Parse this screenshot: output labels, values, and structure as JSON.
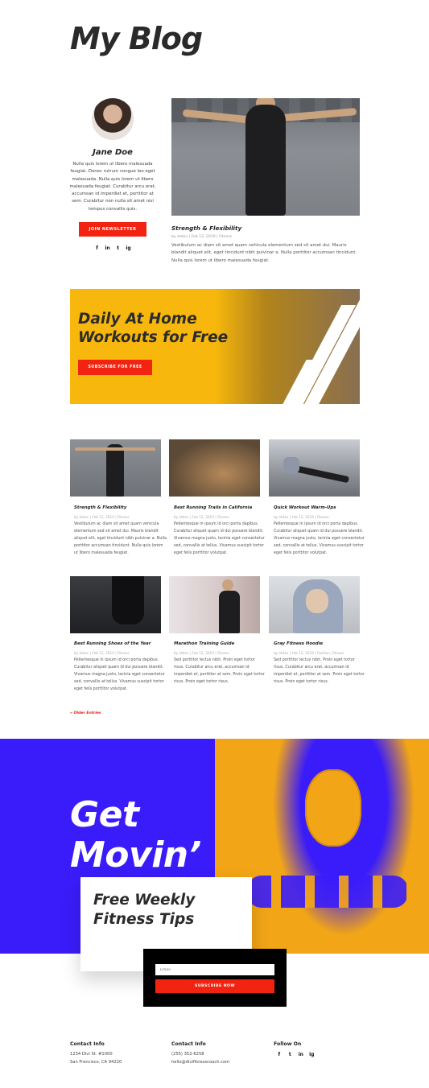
{
  "page_title": "My Blog",
  "author": {
    "name": "Jane Doe",
    "bio": "Nulla quis lorem ut libero malesuada feugiat. Donec rutrum congue leo eget malesuada. Nulla quis lorem ut libero malesuada feugiat. Curabitur arcu erat, accumsan id imperdiet et, porttitor at sem. Curabitur non nulla sit amet nisl tempus convallis quis.",
    "button": "JOIN NEWSLETTER",
    "social": [
      "f",
      "in",
      "t",
      "ig"
    ]
  },
  "featured": {
    "title": "Strength & Flexibility",
    "meta": "by etdev | Feb 12, 2019 | Fitness",
    "excerpt": "Vestibulum ac diam sit amet quam vehicula elementum sed sit amet dui. Mauris blandit aliquet elit, eget tincidunt nibh pulvinar a. Nulla porttitor accumsan tincidunt. Nulla quis lorem ut libero malesuada feugiat."
  },
  "banner": {
    "title": "Daily At Home Workouts for Free",
    "button": "SUBSCRIBE FOR FREE",
    "accent": "#f7b70c"
  },
  "posts": [
    {
      "title": "Strength & Flexibility",
      "meta": "by etdev | Feb 12, 2019 | Fitness",
      "excerpt": "Vestibulum ac diam sit amet quam vehicula elementum sed sit amet dui. Mauris blandit aliquet elit, eget tincidunt nibh pulvinar a. Nulla porttitor accumsan tincidunt. Nulla quis lorem ut libero malesuada feugiat."
    },
    {
      "title": "Best Running Trails in California",
      "meta": "by etdev | Feb 12, 2019 | Fitness",
      "excerpt": "Pellentesque in ipsum id orci porta dapibus. Curabitur aliquet quam id dui posuere blandit. Vivamus magna justo, lacinia eget consectetur sed, convallis at tellus. Vivamus suscipit tortor eget felis porttitor volutpat."
    },
    {
      "title": "Quick Workout Warm-Ups",
      "meta": "by etdev | Feb 12, 2019 | Fitness",
      "excerpt": "Pellentesque in ipsum id orci porta dapibus. Curabitur aliquet quam id dui posuere blandit. Vivamus magna justo, lacinia eget consectetur sed, convallis at tellus. Vivamus suscipit tortor eget felis porttitor volutpat."
    },
    {
      "title": "Best Running Shoes of the Year",
      "meta": "by etdev | Feb 12, 2019 | Fitness",
      "excerpt": "Pellentesque in ipsum id orci porta dapibus. Curabitur aliquet quam id dui posuere blandit. Vivamus magna justo, lacinia eget consectetur sed, convallis at tellus. Vivamus suscipit tortor eget felis porttitor volutpat."
    },
    {
      "title": "Marathon Training Guide",
      "meta": "by etdev | Feb 12, 2019 | Fitness",
      "excerpt": "Sed porttitor lectus nibh. Proin eget tortor risus. Curabitur arcu erat, accumsan id imperdiet et, porttitor at sem. Proin eget tortor risus. Proin eget tortor risus."
    },
    {
      "title": "Gray Fitness Hoodie",
      "meta": "by etdev | Feb 12, 2019 | Fashion, Fitness",
      "excerpt": "Sed porttitor lectus nibh. Proin eget tortor risus. Curabitur arcu erat, accumsan id imperdiet et, porttitor at sem. Proin eget tortor risus. Proin eget tortor risus."
    }
  ],
  "older_entries": "« Older Entries",
  "cta": {
    "line1": "Get",
    "line2": "Movin’",
    "tips": "Free Weekly Fitness Tips",
    "email_placeholder": "Email",
    "button": "SUBSCRIBE NOW",
    "blue": "#3a1cfa",
    "orange": "#f2a516"
  },
  "footer": {
    "col1": {
      "heading": "Contact Info",
      "line1": "1234 Divi St. #1000",
      "line2": "San Francisco, CA 94220"
    },
    "col2": {
      "heading": "Contact Info",
      "line1": "(255) 352-6258",
      "line2": "hello@divifitnesscoach.com"
    },
    "col3": {
      "heading": "Follow On",
      "social": [
        "f",
        "t",
        "in",
        "ig"
      ]
    }
  }
}
